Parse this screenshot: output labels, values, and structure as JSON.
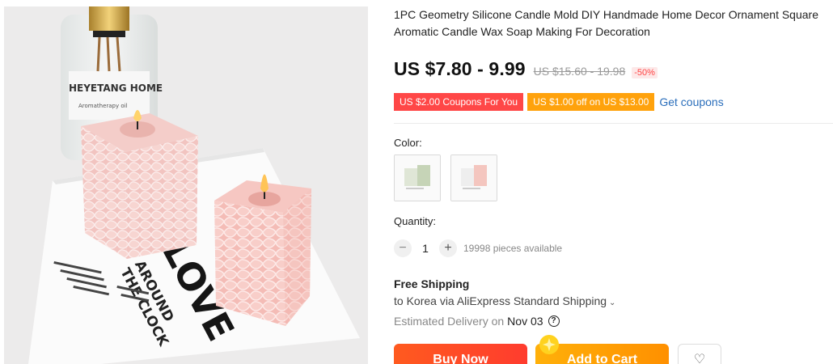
{
  "product": {
    "title": "1PC Geometry Silicone Candle Mold DIY Handmade Home Decor Ornament Square Aromatic Candle Wax Soap Making For Decoration",
    "image_text": {
      "bottle_label": "HEYETANG HOME",
      "bottle_sublabel": "Aromatherapy oil",
      "card_big": "LOVE",
      "card_lines": [
        "AROUND",
        "THE CLOCK"
      ]
    }
  },
  "price": {
    "current": "US $7.80 - 9.99",
    "original": "US $15.60 - 19.98",
    "discount": "-50%"
  },
  "coupons": {
    "coupon1": "US $2.00 Coupons For You",
    "coupon2": "US $1.00 off on US $13.00",
    "get_link": "Get coupons"
  },
  "color": {
    "label": "Color:",
    "options": [
      "green",
      "pink"
    ]
  },
  "quantity": {
    "label": "Quantity:",
    "minus": "−",
    "value": "1",
    "plus": "+",
    "available": "19998 pieces available"
  },
  "shipping": {
    "title": "Free Shipping",
    "detail": "to Korea via AliExpress Standard Shipping",
    "caret": "⌄",
    "estimated_label": "Estimated Delivery on",
    "estimated_date": "Nov 03",
    "help": "?"
  },
  "actions": {
    "buy_now": "Buy Now",
    "add_to_cart": "Add to Cart",
    "wishlist_icon": "♡"
  },
  "colors": {
    "coupon_red": "#ff4747",
    "coupon_orange": "#ffa20c",
    "link_blue": "#2a6ebb",
    "buy_now": "#ff4a25",
    "add_to_cart": "#ffa000"
  }
}
